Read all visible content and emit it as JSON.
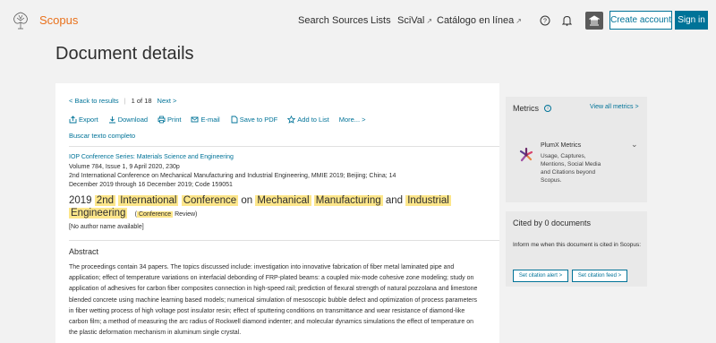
{
  "header": {
    "brand": "Scopus",
    "nav": [
      {
        "label": "Search"
      },
      {
        "label": "Sources"
      },
      {
        "label": "Lists"
      },
      {
        "label": "SciVal",
        "external": true
      },
      {
        "label": "Catálogo en línea",
        "external": true
      }
    ],
    "create_account": "Create account",
    "sign_in": "Sign in",
    "icons": [
      "help-icon",
      "bell-icon",
      "institution-icon"
    ]
  },
  "page_title": "Document details",
  "results_nav": {
    "back": "< Back to results",
    "position": "1 of 18",
    "next": "Next >"
  },
  "toolbar": [
    {
      "label": "Export",
      "icon": "export-icon"
    },
    {
      "label": "Download",
      "icon": "download-icon"
    },
    {
      "label": "Print",
      "icon": "print-icon"
    },
    {
      "label": "E-mail",
      "icon": "email-icon"
    },
    {
      "label": "Save to PDF",
      "icon": "pdf-icon"
    },
    {
      "label": "Add to List",
      "icon": "star-icon"
    },
    {
      "label": "More... >",
      "icon": ""
    }
  ],
  "fulltext_link": "Buscar texto completo",
  "document": {
    "series": "IOP Conference Series: Materials Science and Engineering",
    "volume": "Volume 784, Issue 1, 9 April 2020, 230p",
    "conference_line1": "2nd International Conference on Mechanical Manufacturing and Industrial Engineering, MMIE 2019; Beijing; China; 14",
    "conference_line2": "December 2019 through 16 December 2019; Code 159051",
    "title_year": "2019",
    "title_words": [
      "2nd",
      "International",
      "Conference",
      "on",
      "Mechanical",
      "Manufacturing",
      "and",
      "Industrial",
      "Engineering"
    ],
    "doc_type_word": "Conference",
    "doc_type_rest": "Review)",
    "doc_type_open": "(",
    "authors": "[No author name available]",
    "abstract_heading": "Abstract",
    "abstract": "The proceedings contain 34 papers. The topics discussed include: investigation into innovative fabrication of fiber metal laminated pipe and application; effect of temperature variations on interfacial debonding of FRP-plated beams: a coupled mix-mode cohesive zone modeling; study on application of adhesives for carbon fiber composites connection in high-speed rail; prediction of flexural strength of natural pozzolana and limestone blended concrete using machine learning based models; numerical simulation of mesoscopic bubble defect and optimization of process parameters in fiber wetting process of high voltage post insulator resin; effect of sputtering conditions on transmittance and wear resistance of diamond-like carbon film; a method of measuring the arc radius of Rockwell diamond indenter; and molecular dynamics simulations the effect of temperature on the plastic deformation mechanism in aluminum single crystal."
  },
  "metrics": {
    "title": "Metrics",
    "view_all": "View all metrics >",
    "plumx_title": "PlumX Metrics",
    "plumx_desc": "Usage, Captures, Mentions, Social Media and Citations beyond Scopus."
  },
  "cited": {
    "title": "Cited by 0 documents",
    "text": "Inform me when this document is cited in Scopus:",
    "alert_btn": "Set citation alert >",
    "feed_btn": "Set citation feed >"
  },
  "colors": {
    "brand": "#e9711c",
    "link": "#007398",
    "highlight": "#fde68a"
  }
}
